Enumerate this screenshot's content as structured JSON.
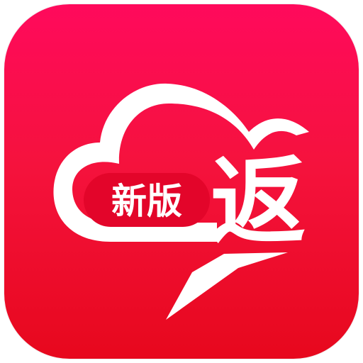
{
  "icon": {
    "badge_label": "新版",
    "main_char": "返",
    "colors": {
      "background_top": "#ff0a5c",
      "background_bottom": "#e7081d",
      "foreground": "#ffffff",
      "badge_text": "#ffffff"
    },
    "icon_names": [
      "cloud-icon",
      "lightning-icon"
    ]
  }
}
